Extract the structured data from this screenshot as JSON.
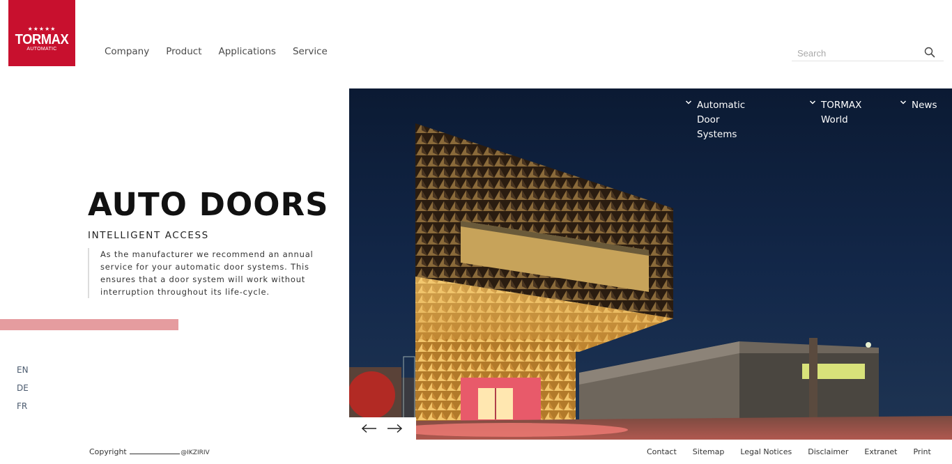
{
  "logo": {
    "stars": "★★★★★",
    "word": "TORMAX",
    "sub": "AUTOMATIC",
    "color": "#c8102e"
  },
  "nav": {
    "items": [
      "Company",
      "Product",
      "Applications",
      "Service"
    ]
  },
  "search": {
    "placeholder": "Search",
    "icon": "search-icon"
  },
  "hero": {
    "title": "AUTO DOORS",
    "subtitle": "INTELLIGENT ACCESS",
    "description": "As the manufacturer we recommend an annual service for your automatic door systems. This ensures that a door system will work without interruption throughout its life-cycle.",
    "accent_bar_color": "#e59c9f"
  },
  "languages": [
    "EN",
    "DE",
    "FR"
  ],
  "sub_nav": {
    "items": [
      {
        "line1": "Automatic Door",
        "line2": "Systems"
      },
      {
        "line1": "TORMAX",
        "line2": "World"
      },
      {
        "line1": "News",
        "line2": ""
      }
    ],
    "icon": "chevron-down-icon"
  },
  "slider": {
    "prev_icon": "arrow-left-icon",
    "next_icon": "arrow-right-icon"
  },
  "footer": {
    "copyright_prefix": "Copyright",
    "copyright_handle": "@IKZIRIV",
    "links": [
      "Contact",
      "Sitemap",
      "Legal Notices",
      "Disclaimer",
      "Extranet",
      "Print"
    ]
  }
}
